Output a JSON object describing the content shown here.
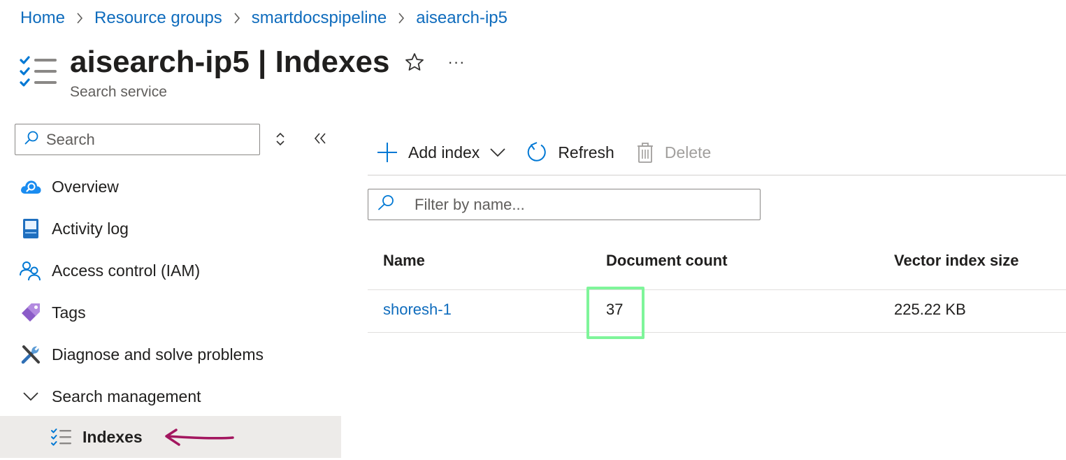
{
  "breadcrumb": [
    {
      "label": "Home"
    },
    {
      "label": "Resource groups"
    },
    {
      "label": "smartdocspipeline"
    },
    {
      "label": "aisearch-ip5"
    }
  ],
  "header": {
    "resource_name": "aisearch-ip5",
    "separator": " | ",
    "page_name": "Indexes",
    "subtitle": "Search service",
    "more_label": "···"
  },
  "sidebar": {
    "search_placeholder": "Search",
    "items": [
      {
        "label": "Overview",
        "icon": "overview-cloud-icon"
      },
      {
        "label": "Activity log",
        "icon": "activity-log-icon"
      },
      {
        "label": "Access control (IAM)",
        "icon": "access-control-icon"
      },
      {
        "label": "Tags",
        "icon": "tag-icon"
      },
      {
        "label": "Diagnose and solve problems",
        "icon": "wrench-icon"
      },
      {
        "label": "Search management",
        "icon": "chevron-down-icon"
      },
      {
        "label": "Indexes",
        "icon": "indexes-icon",
        "selected": true
      }
    ]
  },
  "toolbar": {
    "add_label": "Add index",
    "refresh_label": "Refresh",
    "delete_label": "Delete"
  },
  "filter": {
    "placeholder": "Filter by name..."
  },
  "table": {
    "columns": [
      "Name",
      "Document count",
      "Vector index size"
    ],
    "rows": [
      {
        "name": "shoresh-1",
        "document_count": "37",
        "vector_index_size": "225.22 KB"
      }
    ]
  },
  "colors": {
    "link": "#0f6cbd",
    "highlight": "#7ff59a",
    "annotation_arrow": "#a3165f",
    "selected_bg": "#edebe9"
  }
}
